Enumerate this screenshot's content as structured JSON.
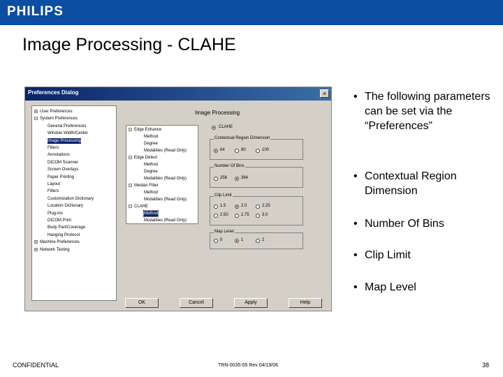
{
  "brand": {
    "logo": "PHILIPS",
    "bar_color": "#0b4ea2"
  },
  "slide": {
    "title": "Image Processing - CLAHE"
  },
  "dialog": {
    "title": "Preferences Dialog",
    "close_label": "×",
    "tree": [
      {
        "label": "User Preferences",
        "expander": "+"
      },
      {
        "label": "System Preferences",
        "expander": "−"
      },
      {
        "label": "General Preferences"
      },
      {
        "label": "Window Width/Center"
      },
      {
        "label": "Image Processing",
        "selected": true
      },
      {
        "label": "Filters"
      },
      {
        "label": "Annotations"
      },
      {
        "label": "DICOM Scanner"
      },
      {
        "label": "Screen Overlays"
      },
      {
        "label": "Paper Printing"
      },
      {
        "label": "Layout"
      },
      {
        "label": "Filters"
      },
      {
        "label": "Customization Dictionary"
      },
      {
        "label": "Location Dictionary"
      },
      {
        "label": "Plug-Ins"
      },
      {
        "label": "DICOM Print"
      },
      {
        "label": "Body Part/Coverage"
      },
      {
        "label": "Hanging Protocol"
      },
      {
        "label": "Machine Preferences",
        "expander": "+"
      },
      {
        "label": "Network Testing",
        "expander": "+"
      }
    ],
    "panel_title": "Image Processing",
    "method_tree": [
      {
        "label": "Edge Enhance",
        "level": 0
      },
      {
        "label": "Method",
        "level": 1
      },
      {
        "label": "Degree",
        "level": 1
      },
      {
        "label": "Modalities (Read Only)",
        "level": 1
      },
      {
        "label": "Edge Detect",
        "level": 0
      },
      {
        "label": "Method",
        "level": 1
      },
      {
        "label": "Degree",
        "level": 1
      },
      {
        "label": "Modalities (Read Only)",
        "level": 1
      },
      {
        "label": "Median Filter",
        "level": 0
      },
      {
        "label": "Method",
        "level": 1
      },
      {
        "label": "Modalities (Read Only)",
        "level": 1
      },
      {
        "label": "CLAHE",
        "level": 0
      },
      {
        "label": "Method",
        "level": 1,
        "selected": true
      },
      {
        "label": "Modalities (Read Only)",
        "level": 1
      }
    ],
    "clahe_option": "CLAHE",
    "groups": {
      "contextual": {
        "label": "Contextual Region Dimension",
        "options": [
          "64",
          "80",
          "100"
        ],
        "selected": 0
      },
      "bins": {
        "label": "Number Of Bins",
        "options": [
          "256",
          "384"
        ],
        "selected": 1
      },
      "clip": {
        "label": "Clip Limit",
        "options": [
          "1.5",
          "2.0",
          "2.25",
          "2.50",
          "2.75",
          "3.0"
        ],
        "selected": 1
      },
      "map": {
        "label": "Map Level",
        "options": [
          "0",
          "1",
          "2"
        ],
        "selected": 1
      }
    },
    "buttons": {
      "ok": "OK",
      "cancel": "Cancel",
      "apply": "Apply",
      "help": "Help"
    }
  },
  "bullets": [
    "The following parameters can be set via the “Preferences”",
    "Contextual Region Dimension",
    "Number Of Bins",
    "Clip Limit",
    "Map Level"
  ],
  "footer": {
    "confidential": "CONFIDENTIAL",
    "doc_ref": "TRN-0035-05 Rev 04/19/06",
    "page": "38"
  }
}
